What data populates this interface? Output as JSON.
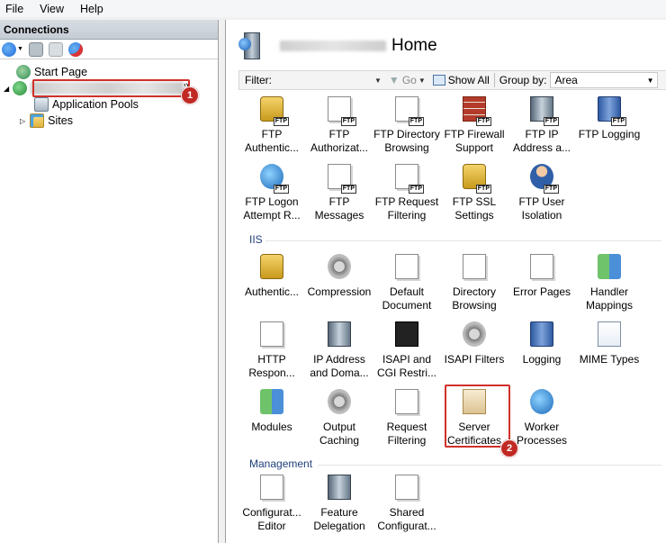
{
  "menu": [
    "File",
    "View",
    "Help"
  ],
  "connections": {
    "header": "Connections",
    "tree": {
      "start_page": "Start Page",
      "server_suffix": "')",
      "app_pools": "Application Pools",
      "sites": "Sites"
    }
  },
  "callouts": {
    "one": "1",
    "two": "2"
  },
  "main": {
    "title": "Home",
    "filter": {
      "label": "Filter:",
      "go": "Go",
      "show_all": "Show All",
      "group_by": "Group by:",
      "group_value": "Area"
    },
    "sections": {
      "iis": "IIS",
      "management": "Management"
    },
    "ftp_items": [
      {
        "l1": "FTP",
        "l2": "Authentic...",
        "icon": "ftp-authentication-icon"
      },
      {
        "l1": "FTP",
        "l2": "Authorizat...",
        "icon": "ftp-authorization-icon"
      },
      {
        "l1": "FTP Directory",
        "l2": "Browsing",
        "icon": "ftp-directory-browsing-icon"
      },
      {
        "l1": "FTP Firewall",
        "l2": "Support",
        "icon": "ftp-firewall-icon"
      },
      {
        "l1": "FTP IP",
        "l2": "Address a...",
        "icon": "ftp-ip-address-icon"
      },
      {
        "l1": "FTP Logging",
        "l2": "",
        "icon": "ftp-logging-icon"
      },
      {
        "l1": "FTP Logon",
        "l2": "Attempt R...",
        "icon": "ftp-logon-attempt-icon"
      },
      {
        "l1": "FTP",
        "l2": "Messages",
        "icon": "ftp-messages-icon"
      },
      {
        "l1": "FTP Request",
        "l2": "Filtering",
        "icon": "ftp-request-filtering-icon"
      },
      {
        "l1": "FTP SSL",
        "l2": "Settings",
        "icon": "ftp-ssl-icon"
      },
      {
        "l1": "FTP User",
        "l2": "Isolation",
        "icon": "ftp-user-isolation-icon"
      }
    ],
    "iis_items": [
      {
        "l1": "Authentic...",
        "l2": "",
        "icon": "authentication-icon"
      },
      {
        "l1": "Compression",
        "l2": "",
        "icon": "compression-icon"
      },
      {
        "l1": "Default",
        "l2": "Document",
        "icon": "default-document-icon"
      },
      {
        "l1": "Directory",
        "l2": "Browsing",
        "icon": "directory-browsing-icon"
      },
      {
        "l1": "Error Pages",
        "l2": "",
        "icon": "error-pages-icon"
      },
      {
        "l1": "Handler",
        "l2": "Mappings",
        "icon": "handler-mappings-icon"
      },
      {
        "l1": "HTTP",
        "l2": "Respon...",
        "icon": "http-response-icon"
      },
      {
        "l1": "IP Address",
        "l2": "and Doma...",
        "icon": "ip-address-icon"
      },
      {
        "l1": "ISAPI and",
        "l2": "CGI Restri...",
        "icon": "isapi-cgi-icon"
      },
      {
        "l1": "ISAPI Filters",
        "l2": "",
        "icon": "isapi-filters-icon"
      },
      {
        "l1": "Logging",
        "l2": "",
        "icon": "logging-icon"
      },
      {
        "l1": "MIME Types",
        "l2": "",
        "icon": "mime-types-icon"
      },
      {
        "l1": "Modules",
        "l2": "",
        "icon": "modules-icon"
      },
      {
        "l1": "Output",
        "l2": "Caching",
        "icon": "output-caching-icon"
      },
      {
        "l1": "Request",
        "l2": "Filtering",
        "icon": "request-filtering-icon"
      },
      {
        "l1": "Server",
        "l2": "Certificates",
        "icon": "server-certificates-icon"
      },
      {
        "l1": "Worker",
        "l2": "Processes",
        "icon": "worker-processes-icon"
      }
    ],
    "mgmt_items": [
      {
        "l1": "Configurat...",
        "l2": "Editor",
        "icon": "configuration-editor-icon"
      },
      {
        "l1": "Feature",
        "l2": "Delegation",
        "icon": "feature-delegation-icon"
      },
      {
        "l1": "Shared",
        "l2": "Configurat...",
        "icon": "shared-configuration-icon"
      }
    ]
  },
  "colors": {
    "callout": "#c12a24",
    "section": "#1f3f7a"
  }
}
